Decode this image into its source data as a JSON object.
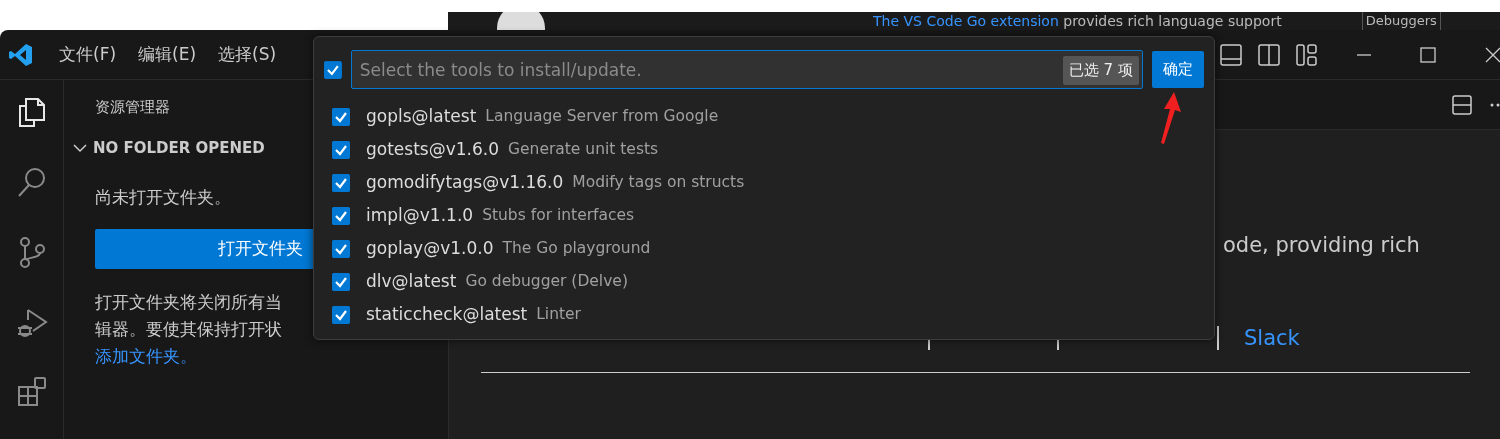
{
  "background_page": {
    "link": "The VS Code Go extension",
    "text": " provides rich language support",
    "tag": "Debuggers"
  },
  "menu": [
    {
      "label": "文件(F)"
    },
    {
      "label": "编辑(E)"
    },
    {
      "label": "选择(S)"
    }
  ],
  "activity_bar": [
    {
      "kind": "explorer",
      "selected": true
    },
    {
      "kind": "search",
      "selected": false
    },
    {
      "kind": "source-control",
      "selected": false
    },
    {
      "kind": "run-debug",
      "selected": false
    },
    {
      "kind": "extensions",
      "selected": false
    }
  ],
  "sidebar": {
    "title": "资源管理器",
    "section": {
      "label": "NO FOLDER OPENED",
      "expanded": true
    },
    "message": "尚未打开文件夹。",
    "button": "打开文件夹",
    "note_lines": [
      "打开文件夹将关闭所有当",
      "辑器。要使其保持打开状"
    ],
    "link": "添加文件夹。"
  },
  "editor": {
    "partial_text": "ode, providing rich",
    "links": [
      "Slack"
    ]
  },
  "quick_pick": {
    "select_all": true,
    "placeholder": "Select the tools to install/update.",
    "count": "已选 7 项",
    "ok": "确定",
    "items": [
      {
        "label": "gopls@latest",
        "description": "Language Server from Google",
        "checked": true
      },
      {
        "label": "gotests@v1.6.0",
        "description": "Generate unit tests",
        "checked": true
      },
      {
        "label": "gomodifytags@v1.16.0",
        "description": "Modify tags on structs",
        "checked": true
      },
      {
        "label": "impl@v1.1.0",
        "description": "Stubs for interfaces",
        "checked": true
      },
      {
        "label": "goplay@v1.0.0",
        "description": "The Go playground",
        "checked": true
      },
      {
        "label": "dlv@latest",
        "description": "Go debugger (Delve)",
        "checked": true
      },
      {
        "label": "staticcheck@latest",
        "description": "Linter",
        "checked": true
      }
    ]
  }
}
